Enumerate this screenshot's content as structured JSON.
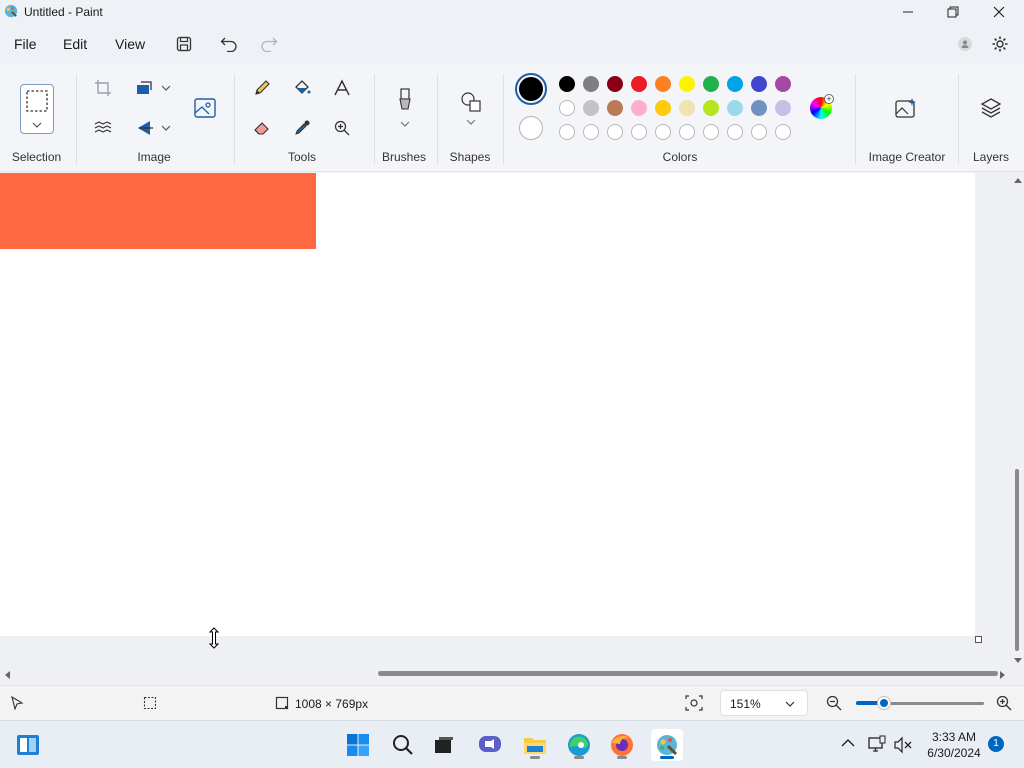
{
  "window": {
    "title": "Untitled - Paint"
  },
  "menu": {
    "file": "File",
    "edit": "Edit",
    "view": "View"
  },
  "ribbon": {
    "groups": {
      "selection": "Selection",
      "image": "Image",
      "tools": "Tools",
      "brushes": "Brushes",
      "shapes": "Shapes",
      "colors": "Colors",
      "image_creator": "Image Creator",
      "layers": "Layers"
    },
    "primary_color": "#000000",
    "secondary_color": "#ffffff",
    "palette_row1": [
      "#000000",
      "#7f7f7f",
      "#880015",
      "#ed1c24",
      "#ff7f27",
      "#fff200",
      "#22b14c",
      "#00a2e8",
      "#3f48cc",
      "#a349a4"
    ],
    "palette_row2": [
      "#ffffff",
      "#c3c3c3",
      "#b97a57",
      "#ffaec9",
      "#ffc90e",
      "#efe4b0",
      "#b5e61d",
      "#99d9ea",
      "#7092be",
      "#c8bfe7"
    ],
    "palette_row3_custom_empty_count": 10
  },
  "canvas": {
    "shape_color": "#ff6a43"
  },
  "status": {
    "canvas_size": "1008 × 769px",
    "zoom": "151%",
    "zoom_level_fraction": 0.22
  },
  "taskbar": {
    "time": "3:33 AM",
    "date": "6/30/2024",
    "notification_count": "1",
    "apps": [
      "start-button",
      "search",
      "file-explorer-task-view",
      "teams-meet",
      "file-explorer",
      "edge",
      "firefox",
      "paint"
    ]
  }
}
